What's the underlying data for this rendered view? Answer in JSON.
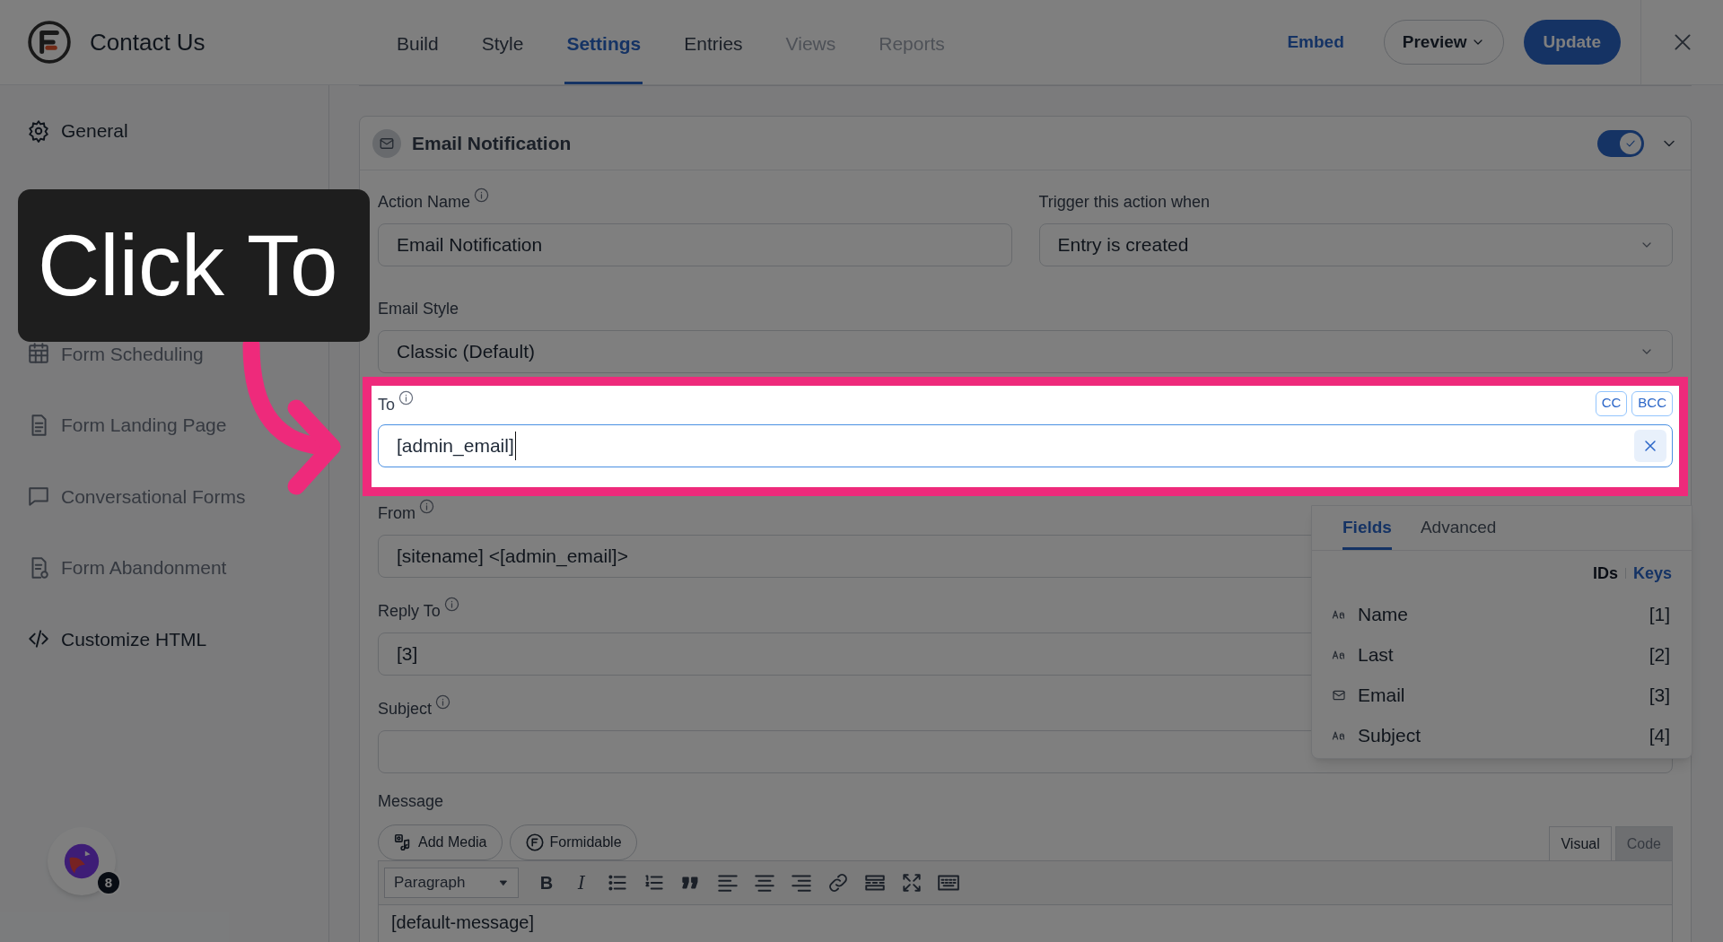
{
  "header": {
    "title": "Contact Us",
    "tabs": [
      {
        "label": "Build",
        "selected": false,
        "disabled": false
      },
      {
        "label": "Style",
        "selected": false,
        "disabled": false
      },
      {
        "label": "Settings",
        "selected": true,
        "disabled": false
      },
      {
        "label": "Entries",
        "selected": false,
        "disabled": false
      },
      {
        "label": "Views",
        "selected": false,
        "disabled": true
      },
      {
        "label": "Reports",
        "selected": false,
        "disabled": true
      }
    ],
    "embed": "Embed",
    "preview": "Preview",
    "update": "Update"
  },
  "sidebar": {
    "items": [
      {
        "kind": "settings",
        "label": "General",
        "selected": false,
        "disabled": false
      },
      {
        "kind": "calendar",
        "label": "Form Scheduling",
        "selected": false,
        "disabled": true
      },
      {
        "kind": "page",
        "label": "Form Landing Page",
        "selected": false,
        "disabled": true
      },
      {
        "kind": "chat",
        "label": "Conversational Forms",
        "selected": false,
        "disabled": true
      },
      {
        "kind": "abandon",
        "label": "Form Abandonment",
        "selected": false,
        "disabled": true
      },
      {
        "kind": "code",
        "label": "Customize HTML",
        "selected": false,
        "disabled": false
      }
    ],
    "badge": {
      "count": "8"
    }
  },
  "action": {
    "title": "Email Notification",
    "on": true,
    "action_name": {
      "label": "Action Name",
      "value": "Email Notification"
    },
    "trigger": {
      "label": "Trigger this action when",
      "value": "Entry is created"
    },
    "email_style": {
      "label": "Email Style",
      "value": "Classic (Default)"
    },
    "to": {
      "label": "To",
      "value": "[admin_email]",
      "buttons": [
        "CC",
        "BCC"
      ]
    },
    "from": {
      "label": "From",
      "value": "[sitename] <[admin_email]>"
    },
    "reply_to": {
      "label": "Reply To",
      "value": "[3]"
    },
    "subject": {
      "label": "Subject"
    },
    "message": {
      "label": "Message",
      "media_buttons": [
        "Add Media",
        "Formidable"
      ],
      "editor_tabs": [
        {
          "label": "Visual",
          "selected": true
        },
        {
          "label": "Code",
          "selected": false
        }
      ],
      "format": "Paragraph",
      "glyphs": [
        "B",
        "I"
      ],
      "content": "[default-message]"
    }
  },
  "field_picker": {
    "tabs": [
      {
        "label": "Fields",
        "selected": true
      },
      {
        "label": "Advanced",
        "selected": false
      }
    ],
    "modes": [
      {
        "label": "IDs",
        "selected": true
      },
      {
        "label": "Keys",
        "selected": false
      }
    ],
    "fields": [
      {
        "kind": "text",
        "label": "Name",
        "id": "[1]"
      },
      {
        "kind": "text",
        "label": "Last",
        "id": "[2]"
      },
      {
        "kind": "email",
        "label": "Email",
        "id": "[3]"
      },
      {
        "kind": "text",
        "label": "Subject",
        "id": "[4]"
      }
    ]
  },
  "callout": {
    "text": "Click To"
  }
}
